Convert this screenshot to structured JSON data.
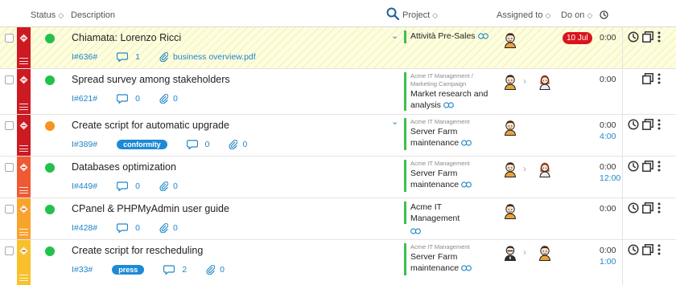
{
  "header": {
    "status": "Status",
    "description": "Description",
    "project": "Project",
    "assigned_to": "Assigned to",
    "do_on": "Do on"
  },
  "colors": {
    "priority_critical": "#cc1a22",
    "priority_high": "#ef5a35",
    "priority_medium": "#f8a42c",
    "priority_low": "#f8c02c",
    "status_green": "#22c24a",
    "status_orange": "#f7931e",
    "project_bar": "#3dc14d",
    "link_blue": "#1f86c8",
    "due_red": "#d9141b"
  },
  "rows": [
    {
      "title": "Chiamata: Lorenzo Ricci",
      "id": "I#636#",
      "comments": "1",
      "attachment": "business overview.pdf",
      "project_super": "",
      "project_name": "Attività Pre-Sales",
      "due_date": "10 Jul",
      "time": "0:00",
      "time2": ""
    },
    {
      "title": "Spread survey among stakeholders",
      "id": "I#621#",
      "comments": "0",
      "attachment": "0",
      "project_super": "Acme IT Management / Marketing Campaign",
      "project_name": "Market research and analysis",
      "time": "0:00",
      "time2": ""
    },
    {
      "title": "Create script for automatic upgrade",
      "id": "I#389#",
      "badge": "conformity",
      "comments": "0",
      "attachment": "0",
      "project_super": "Acme IT Management",
      "project_name": "Server Farm maintenance",
      "time": "0:00",
      "time2": "4:00"
    },
    {
      "title": "Databases optimization",
      "id": "I#449#",
      "comments": "0",
      "attachment": "0",
      "project_super": "Acme IT Management",
      "project_name": "Server Farm maintenance",
      "time": "0:00",
      "time2": "12:00"
    },
    {
      "title": "CPanel & PHPMyAdmin user guide",
      "id": "I#428#",
      "comments": "0",
      "attachment": "0",
      "project_super": "",
      "project_name": "Acme IT Management",
      "time": "0:00",
      "time2": ""
    },
    {
      "title": "Create script for rescheduling",
      "id": "I#33#",
      "badge": "press",
      "comments": "2",
      "attachment": "0",
      "project_super": "Acme IT Management",
      "project_name": "Server Farm maintenance",
      "time": "0:00",
      "time2": "1:00"
    }
  ]
}
